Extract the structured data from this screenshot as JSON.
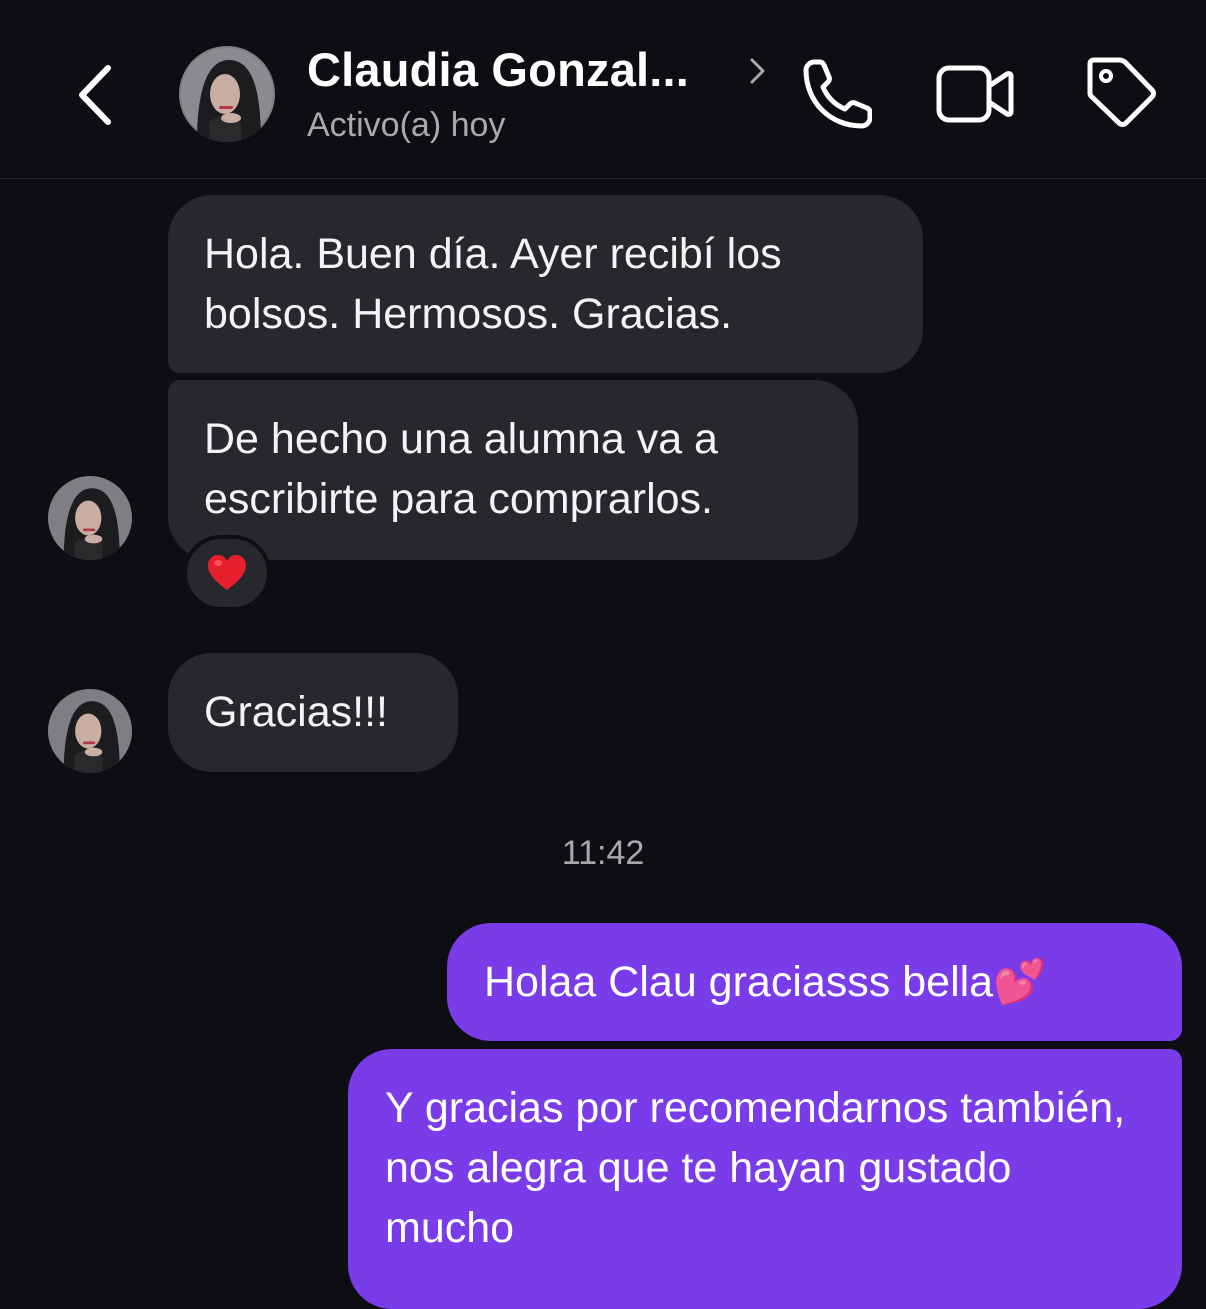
{
  "header": {
    "contact_name": "Claudia Gonzal...",
    "status": "Activo(a) hoy"
  },
  "messages": [
    {
      "direction": "incoming",
      "text": "Hola. Buen día. Ayer recibí los bolsos. Hermosos. Gracias."
    },
    {
      "direction": "incoming",
      "text": "De hecho una alumna va a escribirte para comprarlos.",
      "reaction": "❤️"
    },
    {
      "direction": "incoming",
      "text": "Gracias!!!"
    },
    {
      "direction": "outgoing",
      "text": "Holaa Clau graciasss bella💕"
    },
    {
      "direction": "outgoing",
      "text": "Y gracias por recomendarnos también, nos alegra que te hayan gustado mucho"
    }
  ],
  "timestamp": "11:42",
  "colors": {
    "background": "#0c0e13",
    "incoming_bubble": "#26282d",
    "outgoing_bubble": "#7a3be9",
    "secondary_text": "#a7a9ae"
  },
  "icons": [
    "back-chevron-icon",
    "avatar",
    "chevron-right-icon",
    "phone-icon",
    "video-camera-icon",
    "tag-icon",
    "heart-icon"
  ]
}
